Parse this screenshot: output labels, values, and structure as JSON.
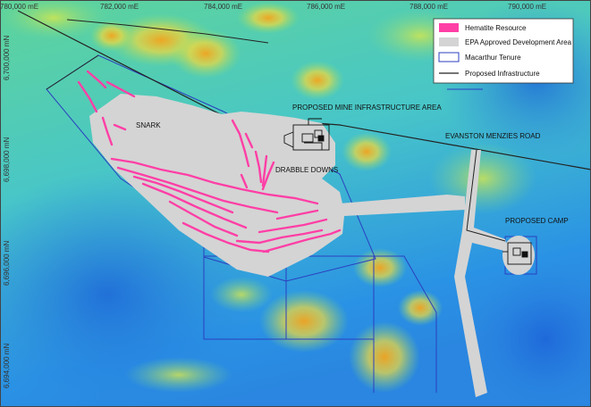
{
  "grid": {
    "easting_labels": [
      "780,000 mE",
      "782,000 mE",
      "784,000 mE",
      "786,000 mE",
      "788,000 mE",
      "790,000 mE"
    ],
    "northing_labels": [
      "6,700,000 mN",
      "6,698,000 mN",
      "6,696,000 mN",
      "6,694,000 mN",
      "6,692,000 mN"
    ]
  },
  "labels": {
    "snark": "SNARK",
    "mine_area": "PROPOSED MINE INFRASTRUCTURE AREA",
    "drabble": "DRABBLE DOWNS",
    "road": "EVANSTON MENZIES ROAD",
    "camp": "PROPOSED CAMP"
  },
  "legend": {
    "hematite": "Hematite Resource",
    "epa": "EPA Approved Development Area",
    "tenure": "Macarthur Tenure",
    "infra": "Proposed Infrastructure"
  },
  "colors": {
    "hematite": "#ff3fa6",
    "epa": "#d4d4d4",
    "tenure": "#2b3fc0",
    "infra": "#222222",
    "terrain_low": "#1f73e0",
    "terrain_mid": "#3cc8c0",
    "terrain_high": "#f0c020",
    "terrain_peak": "#e84010"
  }
}
